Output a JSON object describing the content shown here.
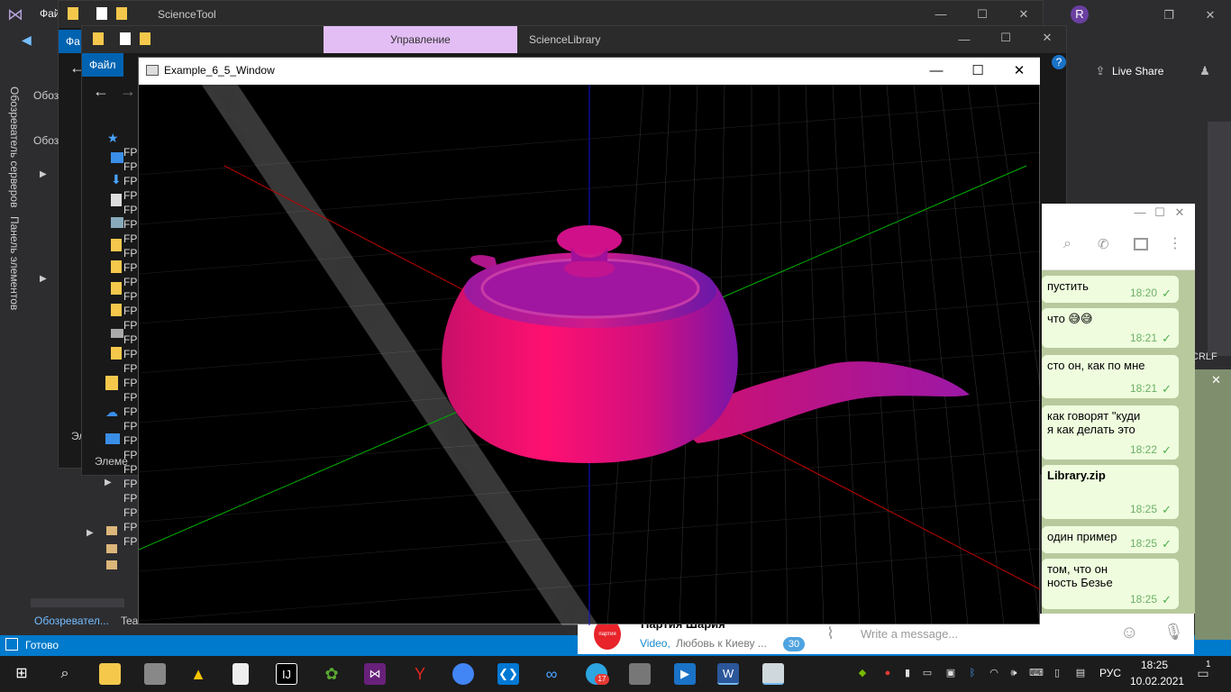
{
  "vs": {
    "menu_file": "Фай",
    "status": "Готово",
    "avatar_letter": "R",
    "live_share": "Live Share",
    "side_tab_1": "Обозреватель серверов",
    "side_tab_2": "Панель элементов",
    "crlf": "CRLF",
    "bottom_tab": "Обозревател...",
    "bottom_tab2": "Tea"
  },
  "explorer_back": {
    "title": "ScienceTool",
    "file_tab": "Фа"
  },
  "explorer_front": {
    "file_tab": "Файл",
    "manage_tab": "Управление",
    "library_tab": "ScienceLibrary",
    "left_label": "Обоз",
    "left_label2": "Обоз",
    "left_bottom": "Эл",
    "left_bottom2": "Элеме",
    "fp_items": [
      "FP",
      "FP",
      "FP",
      "FP",
      "FP",
      "FP",
      "FP",
      "FP",
      "FP",
      "FP",
      "FP",
      "FP",
      "FP",
      "FP",
      "FP",
      "FP",
      "FP",
      "FP",
      "FP",
      "FP",
      "FP",
      "FP",
      "FP",
      "FP",
      "FP",
      "FP",
      "FP",
      "FP"
    ]
  },
  "gl_window": {
    "title": "Example_6_5_Window",
    "minimize": "—",
    "maximize": "☐",
    "close": "✕"
  },
  "telegram": {
    "messages": [
      {
        "text": "пустить",
        "time": "18:20"
      },
      {
        "text": "что 😅😅",
        "time": "18:21"
      },
      {
        "text": "сто он, как по мне",
        "time": "18:21"
      },
      {
        "text": "как говорят \"куди\nя как делать это",
        "time": "18:22"
      },
      {
        "text": "Library.zip",
        "time": "18:25"
      },
      {
        "text": "один пример",
        "time": "18:25"
      },
      {
        "text": "том, что он\nность Безье",
        "time": "18:25"
      }
    ],
    "input_placeholder": "Write a message...",
    "chat_name": "Партия Шария",
    "chat_preview_prefix": "Video,",
    "chat_preview": "Любовь к Киеву ...",
    "unread": "30",
    "avatar_label": "партия Шарий"
  },
  "taskbar": {
    "lang": "РУС",
    "time": "18:25",
    "date": "10.02.2021",
    "telegram_badge": "17",
    "notif_badge": "1"
  }
}
